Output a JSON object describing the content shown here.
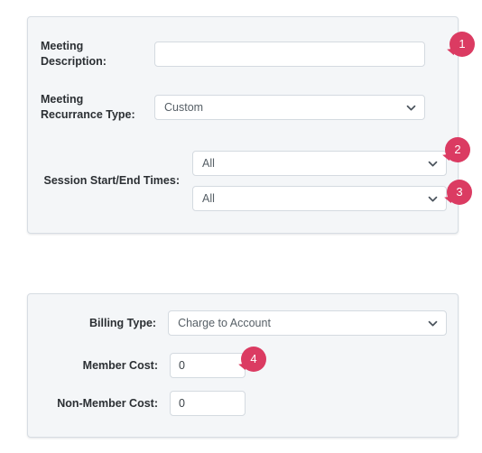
{
  "theme": {
    "page_bg": "#ffffff",
    "card_bg": "#f4f6f8",
    "card_border": "#d7dde3",
    "field_border": "#d4dae0",
    "label_color": "#2b2f33",
    "value_color": "#565f66",
    "badge_color": "#db3b62",
    "badge_text_color": "#ffffff"
  },
  "meeting_card": {
    "fields": {
      "description": {
        "label": "Meeting Description:",
        "value": "",
        "placeholder": ""
      },
      "recurrance_type": {
        "label": "Meeting Recurrance Type:",
        "value": "Custom"
      },
      "session_times": {
        "label": "Session Start/End Times:",
        "start_value": "All",
        "end_value": "All"
      }
    }
  },
  "billing_card": {
    "fields": {
      "billing_type": {
        "label": "Billing Type:",
        "value": "Charge to Account"
      },
      "member_cost": {
        "label": "Member Cost:",
        "value": "0"
      },
      "non_member_cost": {
        "label": "Non-Member Cost:",
        "value": "0"
      }
    }
  },
  "annotations": {
    "badges": [
      {
        "number": "1",
        "target": "meeting-description-input"
      },
      {
        "number": "2",
        "target": "session-start-select"
      },
      {
        "number": "3",
        "target": "session-end-select"
      },
      {
        "number": "4",
        "target": "member-cost-input"
      }
    ]
  },
  "icons": {
    "chevron_down": "chevron-down-icon"
  }
}
